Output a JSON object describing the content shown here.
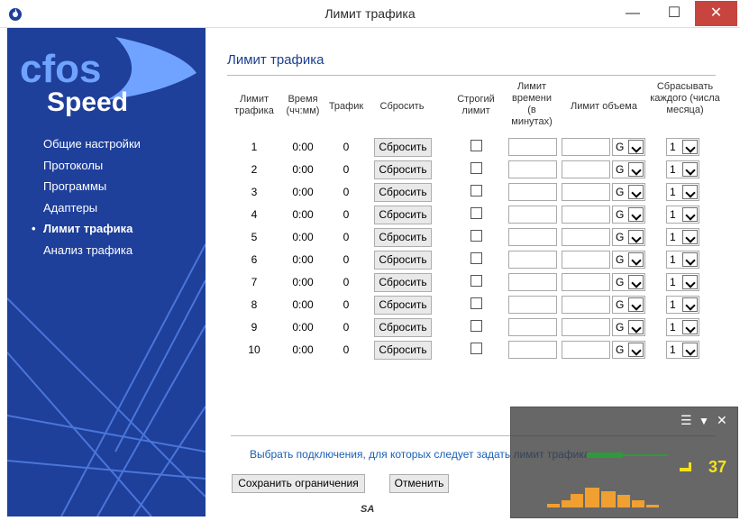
{
  "window": {
    "title": "Лимит трафика",
    "min": "—",
    "max": "☐",
    "close": "✕"
  },
  "logo": {
    "line1": "cfos",
    "line2": "Speed"
  },
  "sidebar": {
    "items": [
      {
        "label": "Общие настройки",
        "active": false
      },
      {
        "label": "Протоколы",
        "active": false
      },
      {
        "label": "Программы",
        "active": false
      },
      {
        "label": "Адаптеры",
        "active": false
      },
      {
        "label": "Лимит трафика",
        "active": true
      },
      {
        "label": "Анализ трафика",
        "active": false
      }
    ]
  },
  "main": {
    "title": "Лимит трафика",
    "headers": {
      "limit": "Лимит трафика",
      "time": "Время (чч:мм)",
      "traffic": "Трафик",
      "reset": "Сбросить",
      "strict": "Строгий лимит",
      "time_limit": "Лимит времени (в минутах)",
      "volume_limit": "Лимит объема",
      "reset_every": "Сбрасывать каждого (числа месяца)"
    },
    "rows": [
      {
        "n": "1",
        "time": "0:00",
        "traffic": "0",
        "reset": "Сбросить",
        "unit": "G",
        "day": "1"
      },
      {
        "n": "2",
        "time": "0:00",
        "traffic": "0",
        "reset": "Сбросить",
        "unit": "G",
        "day": "1"
      },
      {
        "n": "3",
        "time": "0:00",
        "traffic": "0",
        "reset": "Сбросить",
        "unit": "G",
        "day": "1"
      },
      {
        "n": "4",
        "time": "0:00",
        "traffic": "0",
        "reset": "Сбросить",
        "unit": "G",
        "day": "1"
      },
      {
        "n": "5",
        "time": "0:00",
        "traffic": "0",
        "reset": "Сбросить",
        "unit": "G",
        "day": "1"
      },
      {
        "n": "6",
        "time": "0:00",
        "traffic": "0",
        "reset": "Сбросить",
        "unit": "G",
        "day": "1"
      },
      {
        "n": "7",
        "time": "0:00",
        "traffic": "0",
        "reset": "Сбросить",
        "unit": "G",
        "day": "1"
      },
      {
        "n": "8",
        "time": "0:00",
        "traffic": "0",
        "reset": "Сбросить",
        "unit": "G",
        "day": "1"
      },
      {
        "n": "9",
        "time": "0:00",
        "traffic": "0",
        "reset": "Сбросить",
        "unit": "G",
        "day": "1"
      },
      {
        "n": "10",
        "time": "0:00",
        "traffic": "0",
        "reset": "Сбросить",
        "unit": "G",
        "day": "1"
      }
    ],
    "link": "Выбрать подключения, для которых следует задать лимит трафика",
    "save": "Сохранить ограничения",
    "cancel": "Отменить",
    "footer_mark": "SA"
  },
  "overlay": {
    "speed": "37",
    "controls": {
      "menu": "☰",
      "collapse": "▼",
      "close": "✕"
    }
  },
  "colors": {
    "sidebar": "#1e3f9a",
    "title_accent": "#1a3f8f",
    "close": "#c7453e",
    "speed": "#f5e31a",
    "graph": "#f0a030"
  }
}
